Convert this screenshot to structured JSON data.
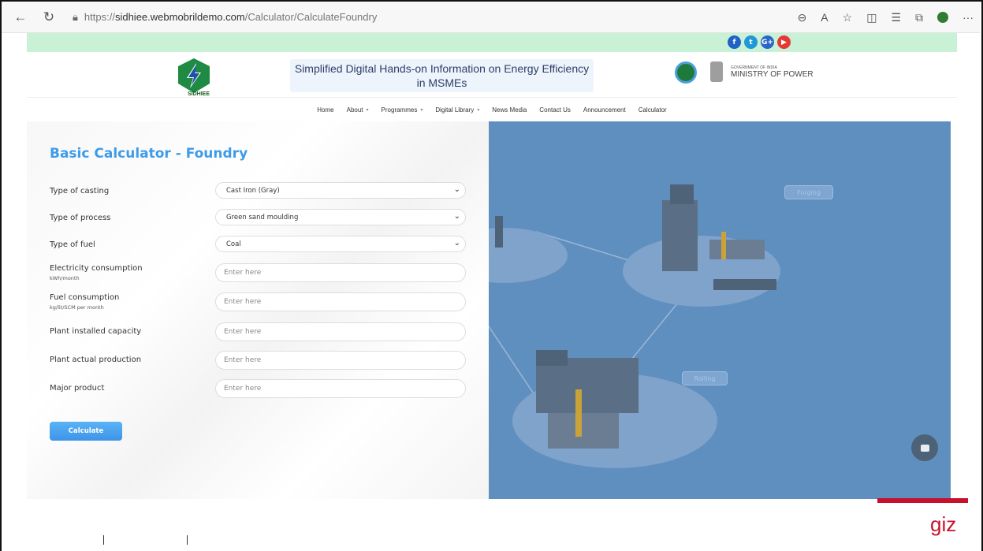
{
  "browser": {
    "url_prefix": "https://",
    "url_host": "sidhiee.webmobrildemo.com",
    "url_path": "/Calculator/CalculateFoundry",
    "more": "···"
  },
  "social": [
    {
      "icon": "facebook-icon",
      "glyph": "f",
      "color": "#1f63c7"
    },
    {
      "icon": "twitter-icon",
      "glyph": "t",
      "color": "#1f97d8"
    },
    {
      "icon": "googleplus-icon",
      "glyph": "G+",
      "color": "#2b67c9"
    },
    {
      "icon": "youtube-icon",
      "glyph": "▶",
      "color": "#e53935"
    }
  ],
  "header": {
    "logo_text": "SIDHIEE",
    "tagline": "Simplified Digital Hands-on Information on Energy Efficiency in MSMEs",
    "gov_small": "GOVERNMENT OF INDIA",
    "ministry": "MINISTRY OF POWER"
  },
  "menu": [
    {
      "label": "Home",
      "dropdown": false
    },
    {
      "label": "About",
      "dropdown": true
    },
    {
      "label": "Programmes",
      "dropdown": true
    },
    {
      "label": "Digital Library",
      "dropdown": true
    },
    {
      "label": "News Media",
      "dropdown": false
    },
    {
      "label": "Contact Us",
      "dropdown": false
    },
    {
      "label": "Announcement",
      "dropdown": false
    },
    {
      "label": "Calculator",
      "dropdown": false
    }
  ],
  "calculator": {
    "title": "Basic Calculator - Foundry",
    "casting_label": "Type of casting",
    "casting_value": "Cast Iron (Gray)",
    "process_label": "Type of process",
    "process_value": "Green sand moulding",
    "fuel_label": "Type of fuel",
    "fuel_value": "Coal",
    "electricity_label": "Electricity consumption",
    "electricity_unit": "kWh/month",
    "electricity_placeholder": "Enter here",
    "fuelcons_label": "Fuel consumption",
    "fuelcons_unit": "kg/lit/SCM per month",
    "fuelcons_placeholder": "Enter here",
    "capacity_label": "Plant installed capacity",
    "capacity_placeholder": "Enter here",
    "production_label": "Plant actual production",
    "production_placeholder": "Enter here",
    "product_label": "Major product",
    "product_placeholder": "Enter here",
    "button": "Calculate"
  },
  "illustration": {
    "tag_forging": "Forging",
    "tag_rolling": "Rolling"
  },
  "footer": {
    "brand": "giz"
  }
}
